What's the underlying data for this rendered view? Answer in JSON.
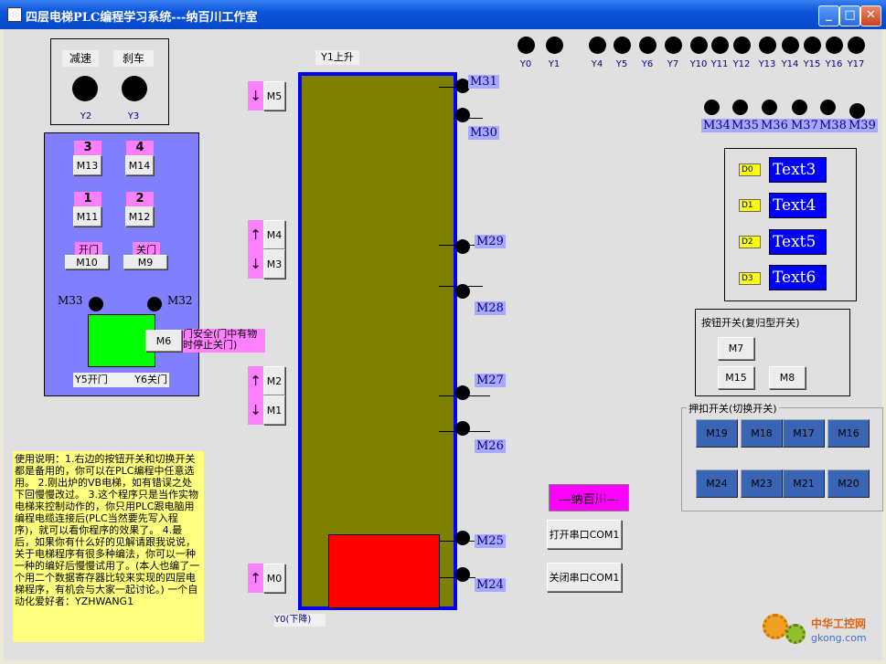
{
  "window": {
    "title": "四层电梯PLC编程学习系统---纳百川工作室",
    "minimize": "_",
    "maximize": "□",
    "close": "✕"
  },
  "brake_panel": {
    "decel": "减速",
    "brake": "刹车",
    "y2": "Y2",
    "y3": "Y3"
  },
  "car_panel": {
    "n3": "3",
    "n4": "4",
    "n1": "1",
    "n2": "2",
    "m13": "M13",
    "m14": "M14",
    "m11": "M11",
    "m12": "M12",
    "open_label": "开门",
    "close_label": "关门",
    "m10": "M10",
    "m9": "M9",
    "m33": "M33",
    "m32": "M32",
    "m6": "M6",
    "y5": "Y5开门",
    "y6": "Y6关门",
    "door_safety": "门安全(门中有物时停止关门)"
  },
  "floor_buttons": {
    "m5": "M5",
    "m4": "M4",
    "m3": "M3",
    "m2": "M2",
    "m1": "M1",
    "m0": "M0"
  },
  "shaft": {
    "top_label": "Y1上升",
    "bottom_label": "Y0(下降)",
    "sensors": [
      "M31",
      "M30",
      "M29",
      "M28",
      "M27",
      "M26",
      "M25",
      "M24"
    ]
  },
  "outputs": {
    "labels": [
      "Y0",
      "Y1",
      "Y4",
      "Y5",
      "Y6",
      "Y7",
      "Y10",
      "Y11",
      "Y12",
      "Y13",
      "Y14",
      "Y15",
      "Y16",
      "Y17"
    ]
  },
  "relays": {
    "labels": [
      "M34",
      "M35",
      "M36",
      "M37",
      "M38",
      "M39"
    ]
  },
  "data_panel": {
    "rows": [
      {
        "reg": "D0",
        "text": "Text3"
      },
      {
        "reg": "D1",
        "text": "Text4"
      },
      {
        "reg": "D2",
        "text": "Text5"
      },
      {
        "reg": "D3",
        "text": "Text6"
      }
    ]
  },
  "momentary": {
    "title": "按钮开关(复归型开关)",
    "m7": "M7",
    "m15": "M15",
    "m8": "M8"
  },
  "toggle": {
    "title": "押扣开关(切换开关)",
    "row1": [
      "M19",
      "M18",
      "M17",
      "M16"
    ],
    "row2": [
      "M24",
      "M23",
      "M21",
      "M20"
    ]
  },
  "brand": "—纳百川—",
  "serial": {
    "open": "打开串口COM1",
    "close": "关闭串口COM1"
  },
  "instructions": "使用说明：1.右边的按钮开关和切换开关都是备用的，你可以在PLC编程中任意选用。 2.刚出炉的VB电梯，如有错误之处下回慢慢改过。 3.这个程序只是当作实物电梯来控制动作的，你只用PLC跟电脑用编程电缆连接后(PLC当然要先写入程序)，就可以看你程序的效果了。 4.最后，如果你有什么好的见解请跟我说说，关于电梯程序有很多种编法，你可以一种一种的编好后慢慢试用了。(本人也编了一个用二个数据寄存器比较来实现的四层电梯程序，有机会与大家一起讨论。) 一个自动化爱好者：YZHWANG1",
  "watermark": {
    "text": "中华工控网",
    "url": "gkong.com"
  }
}
